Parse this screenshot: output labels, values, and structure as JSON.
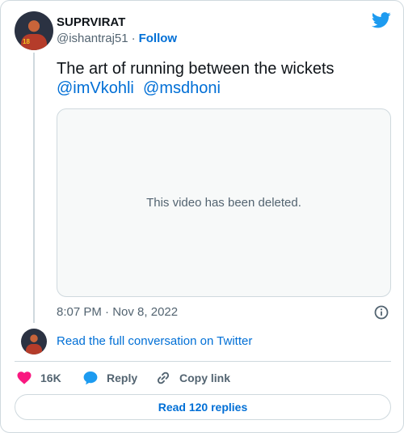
{
  "author": {
    "name": "SUPRVIRAT",
    "handle": "@ishantraj51",
    "separator": "·",
    "follow_label": "Follow",
    "jersey_number": "18"
  },
  "tweet": {
    "text": "The art of running between the wickets",
    "mentions": [
      "@imVkohli",
      "@msdhoni"
    ],
    "media_message": "This video has been deleted.",
    "time": "8:07 PM",
    "date_separator": "·",
    "date": "Nov 8, 2022"
  },
  "conversation": {
    "link_label": "Read the full conversation on Twitter"
  },
  "actions": {
    "likes": "16K",
    "reply_label": "Reply",
    "copy_label": "Copy link"
  },
  "footer": {
    "replies_label": "Read 120 replies"
  },
  "colors": {
    "link": "#006fd6",
    "muted": "#536471",
    "heart": "#f91880",
    "twitter_blue": "#1d9bf0",
    "border": "#cfd9de"
  },
  "icons": [
    "twitter-bird-icon",
    "info-icon",
    "heart-icon",
    "reply-bubble-icon",
    "link-icon"
  ]
}
